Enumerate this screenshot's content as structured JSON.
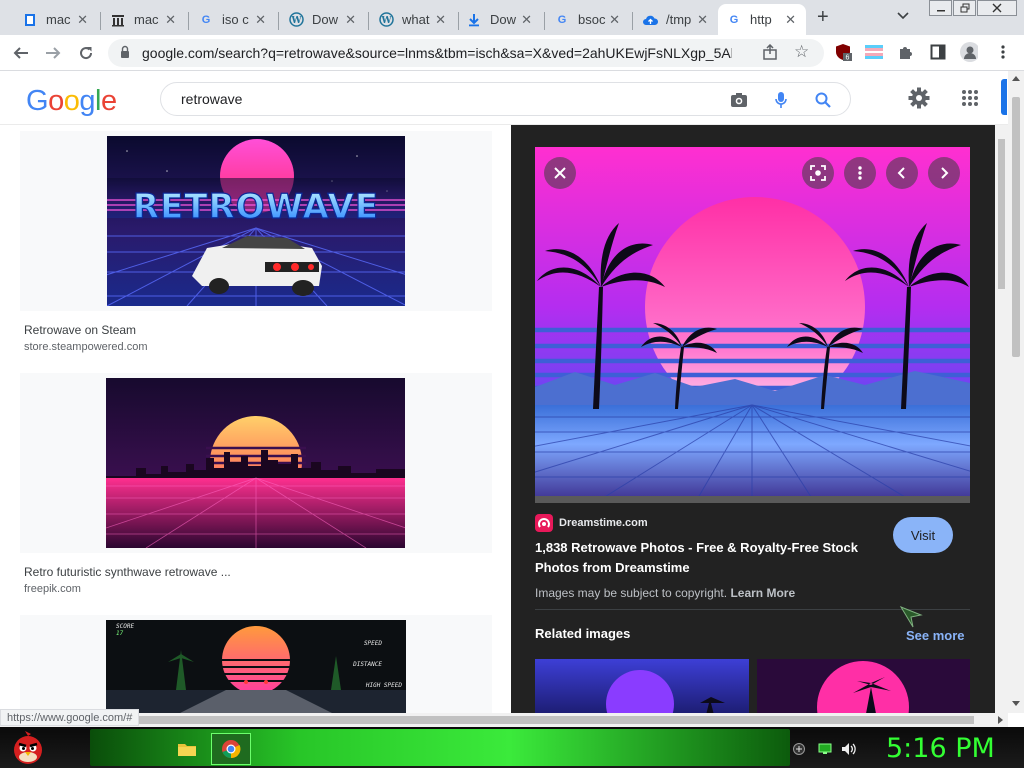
{
  "browser": {
    "tabs": [
      {
        "title": "mac",
        "favicon": "edge-doc-icon"
      },
      {
        "title": "mac",
        "favicon": "archive-icon"
      },
      {
        "title": "iso c",
        "favicon": "google-g-icon"
      },
      {
        "title": "Dow",
        "favicon": "wordpress-icon"
      },
      {
        "title": "what",
        "favicon": "wordpress-icon"
      },
      {
        "title": "Dow",
        "favicon": "download-icon"
      },
      {
        "title": "bsoc",
        "favicon": "google-g-icon"
      },
      {
        "title": "/tmp",
        "favicon": "cloud-upload-icon"
      },
      {
        "title": "http",
        "favicon": "google-g-icon",
        "active": true
      }
    ],
    "new_tab": "+",
    "url": "google.com/search?q=retrowave&source=lnms&tbm=isch&sa=X&ved=2ahUKEwjFsNLXgp_5Ah...",
    "extension_badge": "6",
    "status_url": "https://www.google.com/#"
  },
  "google": {
    "logo": "Google",
    "query": "retrowave"
  },
  "results": [
    {
      "title": "Retrowave on Steam",
      "source": "store.steampowered.com",
      "image_text": "RETROWAVE"
    },
    {
      "title": "Retro futuristic synthwave retrowave ...",
      "source": "freepik.com"
    },
    {
      "title": "",
      "source": "",
      "hud": [
        "SCORE",
        "17",
        "SPEED",
        "DISTANCE",
        "HIGH SPEED"
      ]
    }
  ],
  "preview": {
    "site": "Dreamstime.com",
    "title": "1,838 Retrowave Photos - Free & Royalty-Free Stock Photos from Dreamstime",
    "visit": "Visit",
    "copyright": "Images may be subject to copyright.",
    "learn_more": "Learn More",
    "related": "Related images",
    "see_more": "See more"
  },
  "taskbar": {
    "clock": "5:16 PM"
  },
  "colors": {
    "panel_bg": "#222222",
    "link_blue": "#8ab4f8",
    "clock_green": "#33ff33"
  }
}
